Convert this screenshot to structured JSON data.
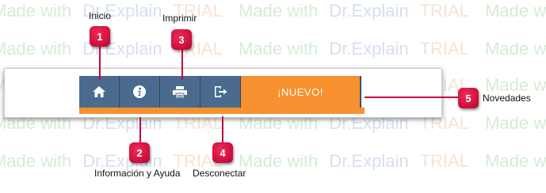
{
  "watermark": {
    "made": "Made with",
    "drx": "Dr.Explain",
    "trial": "TRIAL"
  },
  "toolbar": {
    "buttons": [
      {
        "icon": "home-icon",
        "name": "inicio"
      },
      {
        "icon": "info-icon",
        "name": "informacion"
      },
      {
        "icon": "print-icon",
        "name": "imprimir"
      },
      {
        "icon": "logout-icon",
        "name": "desconectar"
      }
    ],
    "nuevo_label": "¡NUEVO!"
  },
  "callouts": [
    {
      "number": "1",
      "label": "Inicio"
    },
    {
      "number": "2",
      "label": "Información y Ayuda"
    },
    {
      "number": "3",
      "label": "Imprimir"
    },
    {
      "number": "4",
      "label": "Desconectar"
    },
    {
      "number": "5",
      "label": "Novedades"
    }
  ],
  "colors": {
    "button_blue": "#4a6b8d",
    "accent_orange": "#f7902e",
    "callout_red": "#d3103f"
  }
}
